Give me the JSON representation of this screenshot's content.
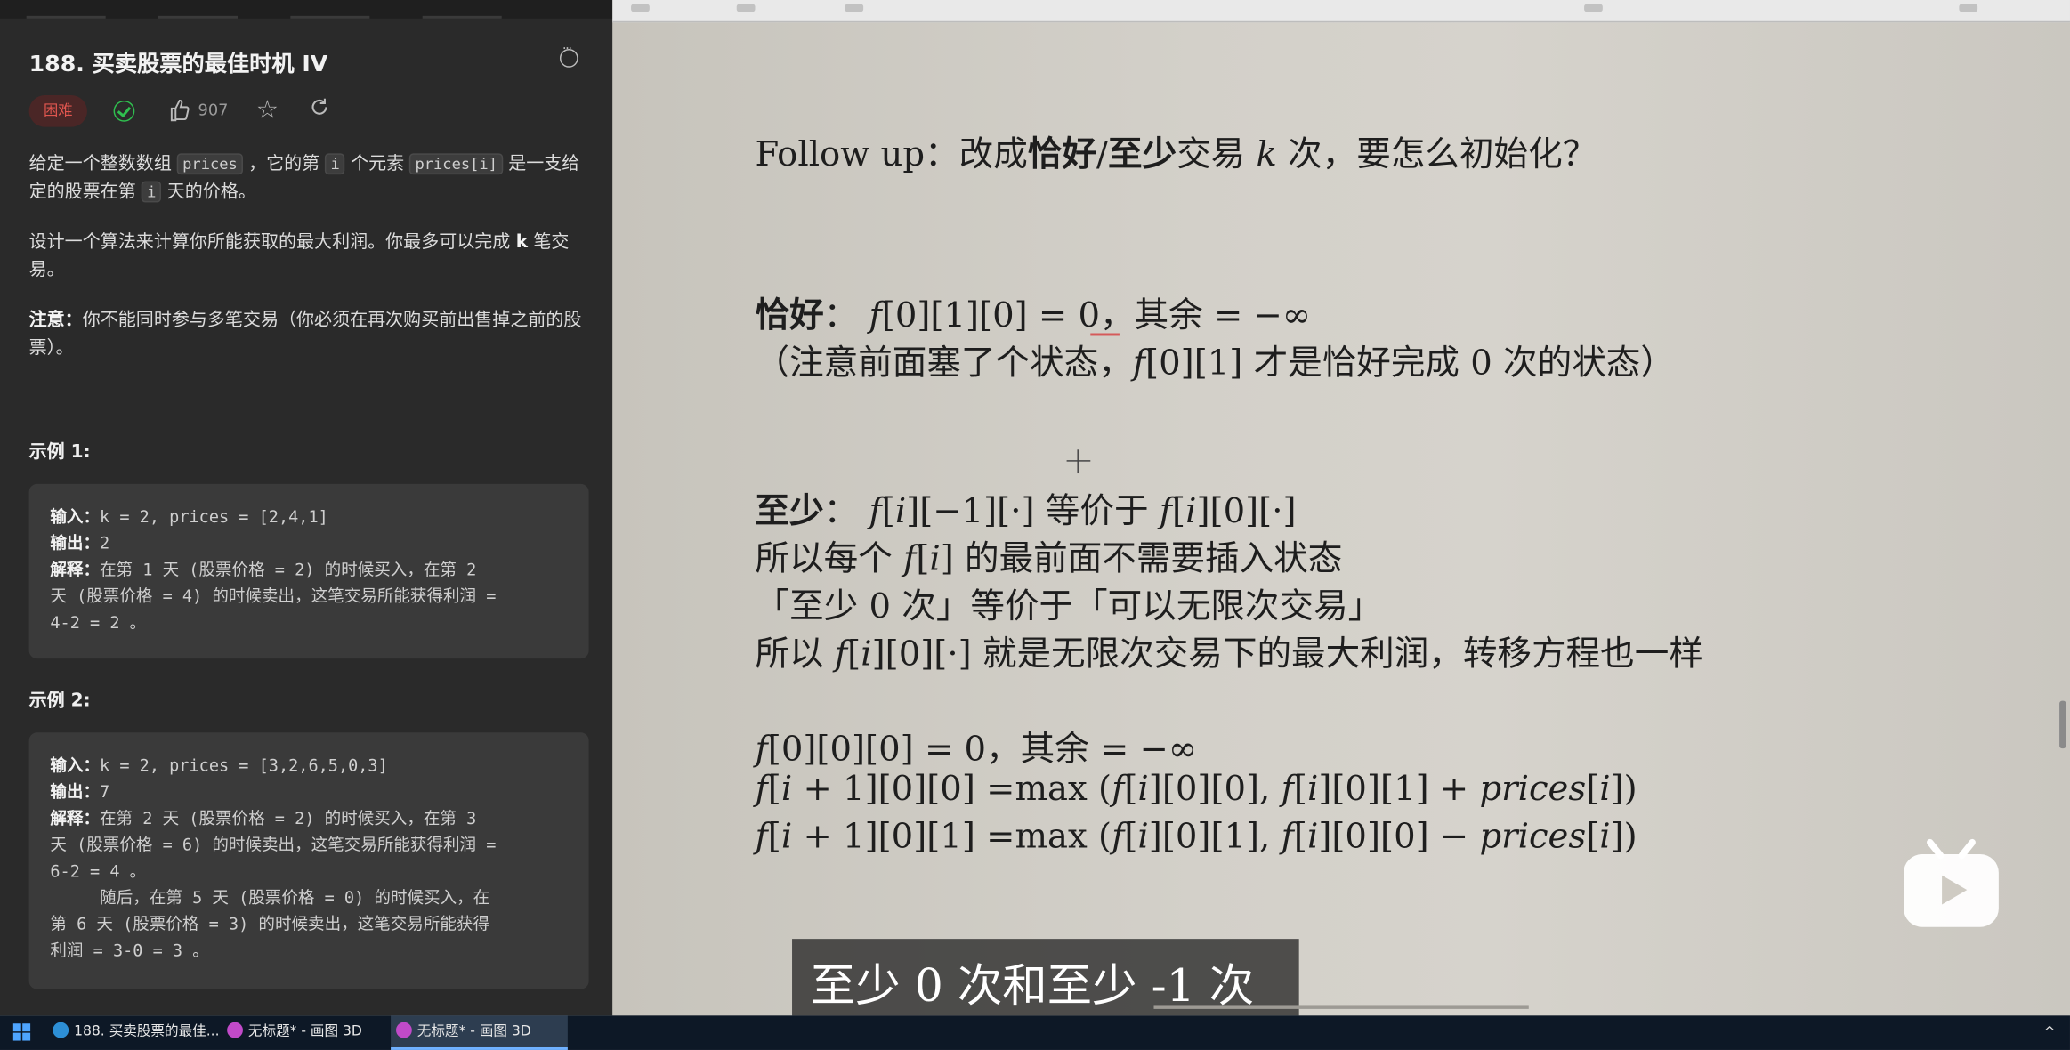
{
  "problem": {
    "title": "188. 买卖股票的最佳时机 IV",
    "difficulty": "困难",
    "likes": "907",
    "desc_p1": [
      {
        "t": "给定一个整数数组 "
      },
      {
        "c": "prices"
      },
      {
        "t": " ，它的第 "
      },
      {
        "c": "i"
      },
      {
        "t": " 个元素 "
      },
      {
        "c": "prices[i]"
      },
      {
        "t": " 是一支给定的股票在第 "
      },
      {
        "c": "i"
      },
      {
        "t": " 天的价格。"
      }
    ],
    "desc_p2": [
      {
        "t": "设计一个算法来计算你所能获取的最大利润。你最多可以完成 "
      },
      {
        "b": "k"
      },
      {
        "t": " 笔交易。"
      }
    ],
    "desc_p3": [
      {
        "b": "注意："
      },
      {
        "t": "你不能同时参与多笔交易（你必须在再次购买前出售掉之前的股票）。"
      }
    ],
    "example1": {
      "heading": "示例 1:",
      "lines": [
        [
          {
            "b": "输入："
          },
          {
            "t": "k = 2, prices = [2,4,1]"
          }
        ],
        [
          {
            "b": "输出："
          },
          {
            "t": "2"
          }
        ],
        [
          {
            "b": "解释："
          },
          {
            "t": "在第 1 天 (股票价格 = 2) 的时候买入，在第 2"
          }
        ],
        [
          {
            "t": "天 (股票价格 = 4) 的时候卖出，这笔交易所能获得利润 ="
          }
        ],
        [
          {
            "t": "4-2 = 2 。"
          }
        ]
      ]
    },
    "example2": {
      "heading": "示例 2:",
      "lines": [
        [
          {
            "b": "输入："
          },
          {
            "t": "k = 2, prices = [3,2,6,5,0,3]"
          }
        ],
        [
          {
            "b": "输出："
          },
          {
            "t": "7"
          }
        ],
        [
          {
            "b": "解释："
          },
          {
            "t": "在第 2 天 (股票价格 = 2) 的时候买入，在第 3"
          }
        ],
        [
          {
            "t": "天 (股票价格 = 6) 的时候卖出，这笔交易所能获得利润 ="
          }
        ],
        [
          {
            "t": "6-2 = 4 。"
          }
        ],
        [
          {
            "t": "     随后，在第 5 天 (股票价格 = 0) 的时候买入，在"
          }
        ],
        [
          {
            "t": "第 6 天 (股票价格 = 3) 的时候卖出，这笔交易所能获得"
          }
        ],
        [
          {
            "t": "利润 = 3-0 = 3 。"
          }
        ]
      ]
    }
  },
  "slide": {
    "followup": [
      {
        "t": "Follow up：改成"
      },
      {
        "k": "恰好"
      },
      {
        "t": "/"
      },
      {
        "k": "至少"
      },
      {
        "t": "交易 "
      },
      {
        "m": "k"
      },
      {
        "t": " 次，要怎么初始化？"
      }
    ],
    "exact_1": [
      {
        "k": "恰好"
      },
      {
        "t": "： "
      },
      {
        "m": "f"
      },
      {
        "t": "[0][1][0] = 0，其余 = −∞"
      }
    ],
    "exact_2": [
      {
        "t": "（注意前面塞了个状态，"
      },
      {
        "m": "f"
      },
      {
        "t": "[0][1] 才是恰好完成 0 次的状态）"
      }
    ],
    "least_1": [
      {
        "k": "至少"
      },
      {
        "t": "： "
      },
      {
        "m": "f"
      },
      {
        "t": "["
      },
      {
        "m": "i"
      },
      {
        "t": "][−1][·] 等价于 "
      },
      {
        "m": "f"
      },
      {
        "t": "["
      },
      {
        "m": "i"
      },
      {
        "t": "][0][·]"
      }
    ],
    "least_2": [
      {
        "t": "所以每个 "
      },
      {
        "m": "f"
      },
      {
        "t": "["
      },
      {
        "m": "i"
      },
      {
        "t": "] 的最前面不需要插入状态"
      }
    ],
    "least_3": [
      {
        "t": "「至少 0 次」等价于「可以无限次交易」"
      }
    ],
    "least_4": [
      {
        "t": "所以 "
      },
      {
        "m": "f"
      },
      {
        "t": "["
      },
      {
        "m": "i"
      },
      {
        "t": "][0][·] 就是无限次交易下的最大利润，转移方程也一样"
      }
    ],
    "eq_1": [
      {
        "m": "f"
      },
      {
        "t": "[0][0][0] = 0，其余 = −∞"
      }
    ],
    "eq_2": [
      {
        "m": "f"
      },
      {
        "t": "["
      },
      {
        "m": "i"
      },
      {
        "t": " + 1][0][0] =max ("
      },
      {
        "m": "f"
      },
      {
        "t": "["
      },
      {
        "m": "i"
      },
      {
        "t": "][0][0], "
      },
      {
        "m": "f"
      },
      {
        "t": "["
      },
      {
        "m": "i"
      },
      {
        "t": "][0][1] + "
      },
      {
        "m": "prices"
      },
      {
        "t": "["
      },
      {
        "m": "i"
      },
      {
        "t": "])"
      }
    ],
    "eq_3": [
      {
        "m": "f"
      },
      {
        "t": "["
      },
      {
        "m": "i"
      },
      {
        "t": " + 1][0][1] =max ("
      },
      {
        "m": "f"
      },
      {
        "t": "["
      },
      {
        "m": "i"
      },
      {
        "t": "][0][1], "
      },
      {
        "m": "f"
      },
      {
        "t": "["
      },
      {
        "m": "i"
      },
      {
        "t": "][0][0] − "
      },
      {
        "m": "prices"
      },
      {
        "t": "["
      },
      {
        "m": "i"
      },
      {
        "t": "])"
      }
    ]
  },
  "subtitle": "至少 0 次和至少 -1 次",
  "taskbar": {
    "items": [
      "188. 买卖股票的最佳...",
      "无标题* - 画图 3D",
      "无标题* - 画图 3D"
    ],
    "icons": [
      "edge-icon",
      "paint3d-icon",
      "paint3d-icon"
    ]
  },
  "colors": {
    "accent": "#6fb1ff",
    "difficulty_hard": "#e0564f",
    "accepted": "#2fbf4f"
  }
}
